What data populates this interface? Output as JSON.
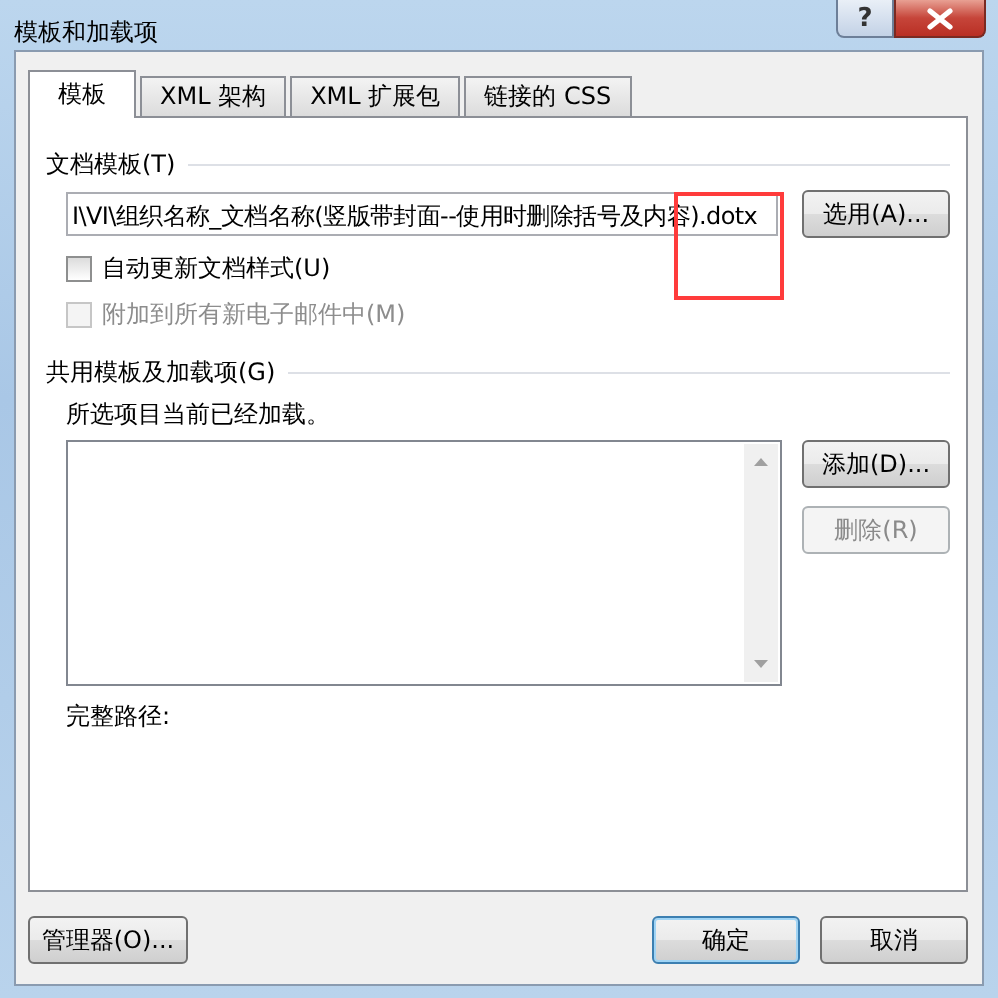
{
  "window": {
    "title": "模板和加载项",
    "help_button": "?"
  },
  "tabs": [
    {
      "label": "模板",
      "selected": true
    },
    {
      "label": "XML 架构",
      "selected": false
    },
    {
      "label": "XML 扩展包",
      "selected": false
    },
    {
      "label": "链接的 CSS",
      "selected": false
    }
  ],
  "template": {
    "label": "文档模板(T)",
    "path": "I\\VI\\组织名称_文档名称(竖版带封面--使用时删除括号及内容).dotx",
    "button": "选用(A)..."
  },
  "checkboxes": [
    {
      "label": "自动更新文档样式(U)",
      "checked": false,
      "disabled": false
    },
    {
      "label": "附加到所有新电子邮件中(M)",
      "checked": false,
      "disabled": true
    }
  ],
  "shared": {
    "label": "共用模板及加载项(G)",
    "note": "所选项目当前已经加载。",
    "full_path_label": "完整路径:",
    "buttons": [
      {
        "label": "添加(D)...",
        "disabled": false
      },
      {
        "label": "删除(R)",
        "disabled": true
      }
    ]
  },
  "footer_buttons": [
    {
      "label": "管理器(O)...",
      "default": false
    },
    {
      "label": "确定",
      "default": true
    },
    {
      "label": "取消",
      "default": false
    }
  ],
  "annotation": {
    "kind": "highlight-box"
  }
}
